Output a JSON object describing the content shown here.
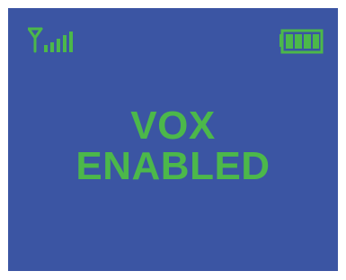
{
  "status_bar": {
    "signal_icon": "signal-strength-icon",
    "signal_bars": 5,
    "battery_icon": "battery-full-icon",
    "battery_level": 1.0
  },
  "message": {
    "line1": "VOX",
    "line2": "ENABLED"
  },
  "colors": {
    "background": "#3b55a3",
    "accent": "#4cb84a"
  }
}
